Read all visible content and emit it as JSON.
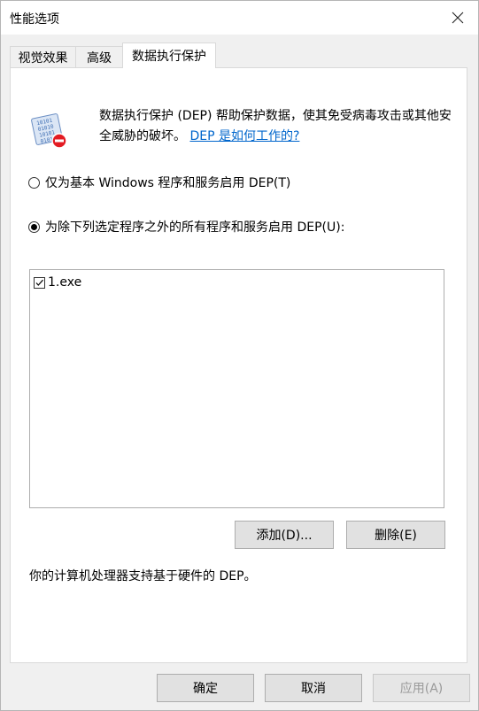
{
  "window": {
    "title": "性能选项"
  },
  "tabs": [
    {
      "label": "视觉效果",
      "active": false
    },
    {
      "label": "高级",
      "active": false
    },
    {
      "label": "数据执行保护",
      "active": true
    }
  ],
  "dep": {
    "description": "数据执行保护 (DEP) 帮助保护数据，使其免受病毒攻击或其他安全威胁的破坏。",
    "link": "DEP 是如何工作的?",
    "options": [
      {
        "label": "仅为基本 Windows 程序和服务启用 DEP(T)",
        "checked": false
      },
      {
        "label": "为除下列选定程序之外的所有程序和服务启用 DEP(U):",
        "checked": true
      }
    ],
    "programs": [
      {
        "name": "1.exe",
        "checked": true
      }
    ],
    "add_label": "添加(D)...",
    "remove_label": "删除(E)",
    "hardware_support": "你的计算机处理器支持基于硬件的 DEP。"
  },
  "footer": {
    "ok_label": "确定",
    "cancel_label": "取消",
    "apply_label": "应用(A)"
  }
}
